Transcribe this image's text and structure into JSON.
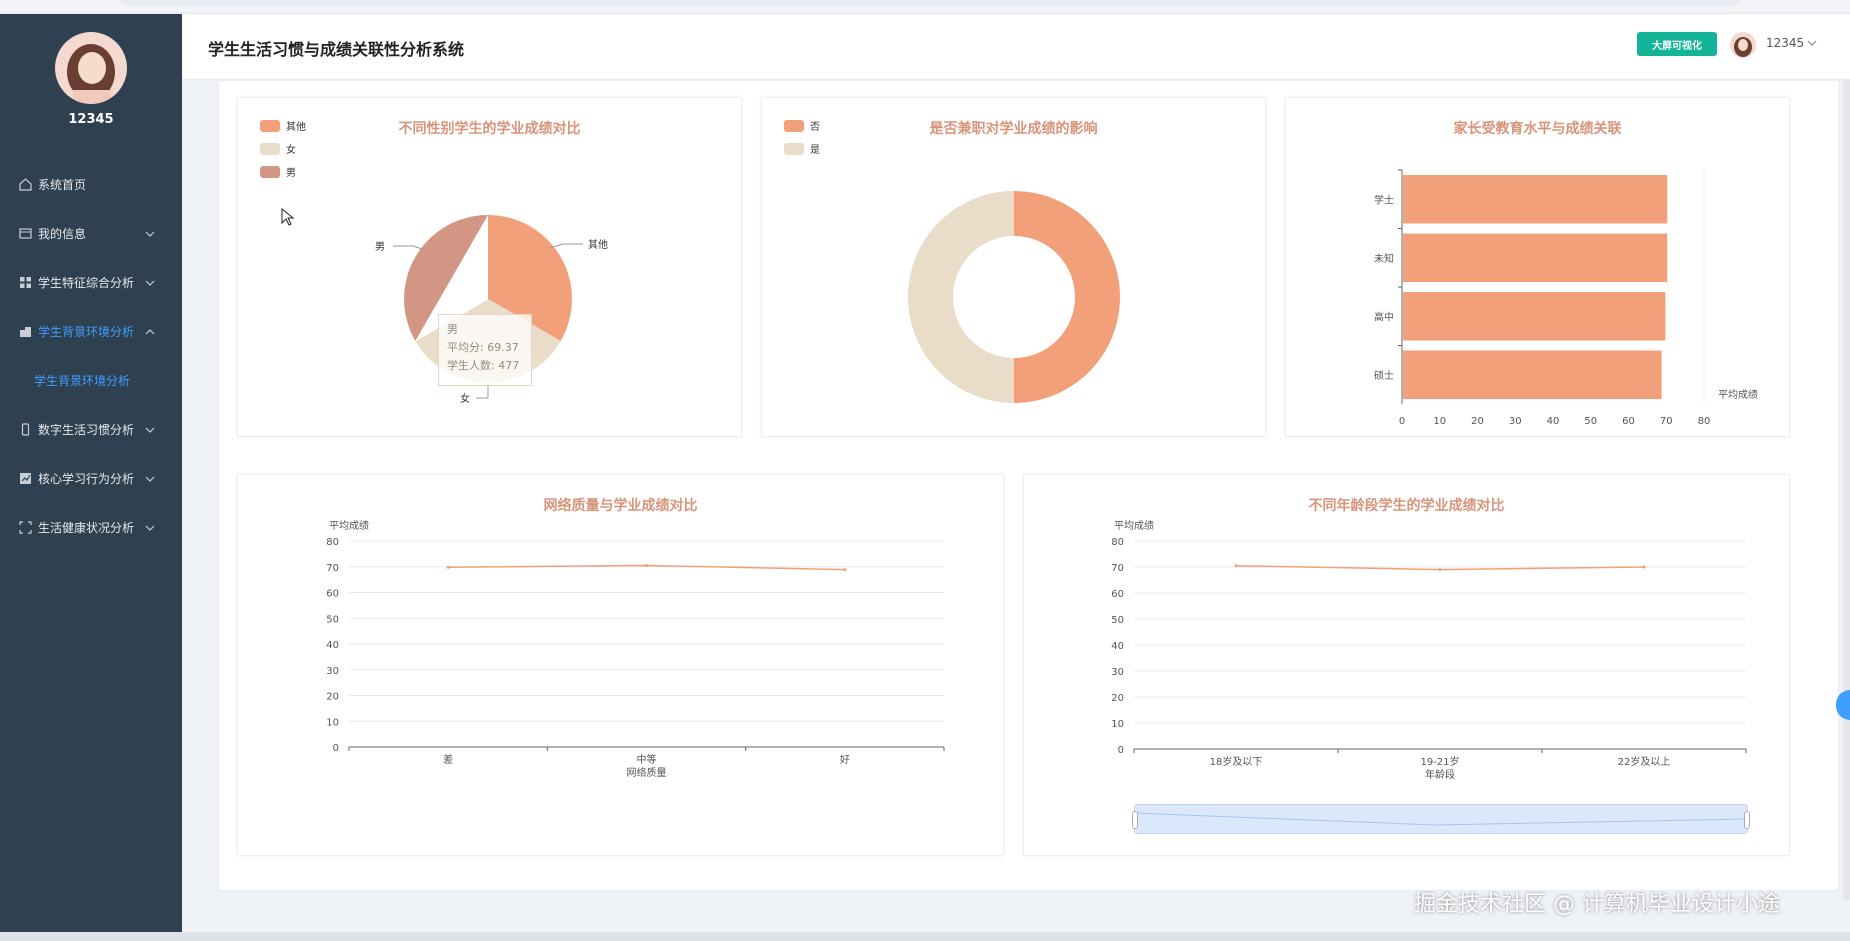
{
  "app": {
    "title": "学生生活习惯与成绩关联性分析系统"
  },
  "user": {
    "name": "12345"
  },
  "header": {
    "big_screen_label": "大屏可视化",
    "user_name": "12345"
  },
  "menu": [
    {
      "label": "系统首页",
      "icon": "home-icon",
      "chevron": false
    },
    {
      "label": "我的信息",
      "icon": "id-card-icon",
      "chevron": true
    },
    {
      "label": "学生特征综合分析",
      "icon": "grid-icon",
      "chevron": true
    },
    {
      "label": "学生背景环境分析",
      "icon": "building-icon",
      "chevron": true,
      "active": true
    },
    {
      "label": "学生背景环境分析",
      "sub": true
    },
    {
      "label": "数字生活习惯分析",
      "icon": "phone-icon",
      "chevron": true
    },
    {
      "label": "核心学习行为分析",
      "icon": "chart-icon",
      "chevron": true
    },
    {
      "label": "生活健康状况分析",
      "icon": "expand-icon",
      "chevron": true
    }
  ],
  "colors": {
    "orange": "#f1a07a",
    "beige": "#e9dcc9",
    "brown": "#d29684",
    "accent": "#409eff",
    "green": "#13b497"
  },
  "chart_data": [
    {
      "type": "pie",
      "title": "不同性别学生的学业成绩对比",
      "legend": [
        "其他",
        "女",
        "男"
      ],
      "slices": [
        {
          "label": "其他",
          "value": 33.3
        },
        {
          "label": "女",
          "value": 33.3
        },
        {
          "label": "男",
          "value": 33.3
        }
      ],
      "tooltip": {
        "title": "男",
        "line1": "平均分: 69.37",
        "line2": "学生人数: 477"
      }
    },
    {
      "type": "pie",
      "title": "是否兼职对学业成绩的影响",
      "legend": [
        "否",
        "是"
      ],
      "slices": [
        {
          "label": "否",
          "value": 50
        },
        {
          "label": "是",
          "value": 50
        }
      ]
    },
    {
      "type": "bar",
      "title": "家长受教育水平与成绩关联",
      "categories": [
        "学士",
        "未知",
        "高中",
        "硕士"
      ],
      "values": [
        70,
        70,
        69.5,
        68.5
      ],
      "xlabel": "平均成绩",
      "xlim": [
        0,
        80
      ],
      "ticks": [
        "0",
        "10",
        "20",
        "30",
        "40",
        "50",
        "60",
        "70",
        "80"
      ]
    },
    {
      "type": "line",
      "title": "网络质量与学业成绩对比",
      "categories": [
        "差",
        "中等",
        "好"
      ],
      "values": [
        69.8,
        70.5,
        68.9
      ],
      "xlabel": "网络质量",
      "ylabel": "平均成绩",
      "ylim": [
        0,
        80
      ],
      "ticks": [
        "0",
        "10",
        "20",
        "30",
        "40",
        "50",
        "60",
        "70",
        "80"
      ]
    },
    {
      "type": "line",
      "title": "不同年龄段学生的学业成绩对比",
      "categories": [
        "18岁及以下",
        "19-21岁",
        "22岁及以上"
      ],
      "values": [
        70.5,
        69.0,
        70.0
      ],
      "xlabel": "年龄段",
      "ylabel": "平均成绩",
      "ylim": [
        0,
        80
      ],
      "ticks": [
        "0",
        "10",
        "20",
        "30",
        "40",
        "50",
        "60",
        "70",
        "80"
      ]
    }
  ],
  "watermark": "掘金技术社区 @ 计算机毕业设计小途"
}
